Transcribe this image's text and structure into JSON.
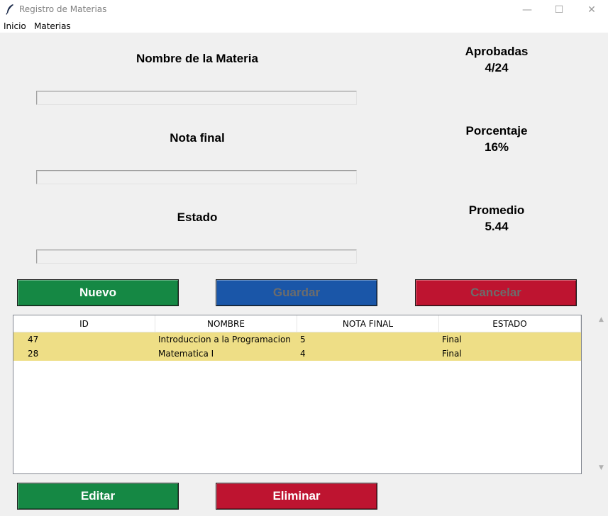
{
  "window": {
    "title": "Registro de Materias",
    "minimize": "—",
    "maximize": "☐",
    "close": "✕"
  },
  "menu": {
    "items": [
      "Inicio",
      "Materias"
    ]
  },
  "form": {
    "name_label": "Nombre de la Materia",
    "name_value": "",
    "grade_label": "Nota final",
    "grade_value": "",
    "status_label": "Estado",
    "status_value": ""
  },
  "stats": {
    "approved_label": "Aprobadas",
    "approved_value": "4/24",
    "percent_label": "Porcentaje",
    "percent_value": "16%",
    "average_label": "Promedio",
    "average_value": "5.44"
  },
  "buttons": {
    "new": "Nuevo",
    "save": "Guardar",
    "cancel": "Cancelar",
    "edit": "Editar",
    "delete": "Eliminar"
  },
  "colors": {
    "green": "#158844",
    "blue": "#1a56a8",
    "red": "#be1430",
    "row_highlight": "#eede86"
  },
  "table": {
    "columns": [
      "ID",
      "NOMBRE",
      "NOTA FINAL",
      "ESTADO"
    ],
    "rows": [
      [
        "47",
        "Introduccion a la Programacion",
        "5",
        "Final"
      ],
      [
        "28",
        "Matematica I",
        "4",
        "Final"
      ]
    ]
  },
  "scrollbar": {
    "up": "▲",
    "down": "▼"
  }
}
